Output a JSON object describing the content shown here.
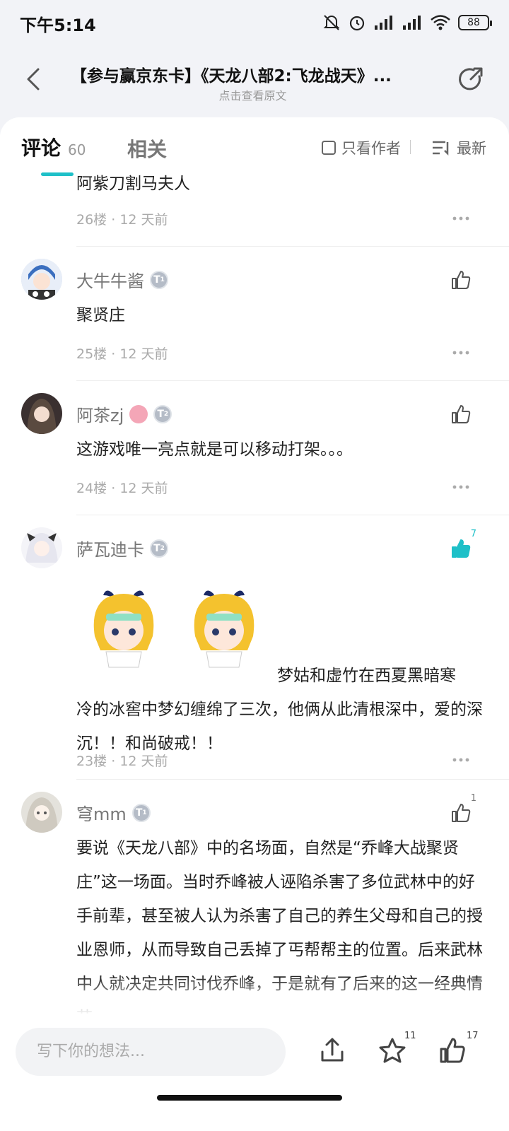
{
  "status_bar": {
    "time": "下午5:14",
    "battery": "88"
  },
  "header": {
    "title": "【参与赢京东卡】《天龙八部2:飞龙战天》...",
    "subtitle": "点击查看原文"
  },
  "tabs": {
    "comments_label": "评论",
    "comments_count": "60",
    "related_label": "相关",
    "only_author": "只看作者",
    "sort": "最新"
  },
  "comments": [
    {
      "text": "阿紫刀割马夫人",
      "floor": "26楼",
      "time": "12 天前"
    },
    {
      "user": "大牛牛酱",
      "level": "1",
      "text": "聚贤庄",
      "floor": "25楼",
      "time": "12 天前"
    },
    {
      "user": "阿茶zj",
      "level": "2",
      "text": "这游戏唯一亮点就是可以移动打架。。。",
      "floor": "24楼",
      "time": "12 天前"
    },
    {
      "user": "萨瓦迪卡",
      "level": "2",
      "likes": "7",
      "text_line1": "梦姑和虚竹在西夏黑暗寒",
      "text_rest": "冷的冰窖中梦幻缠绵了三次，他俩从此清根深中，爱的深沉！！和尚破戒！！",
      "floor": "23楼",
      "time": "12 天前"
    },
    {
      "user": "穹mm",
      "level": "1",
      "likes": "1",
      "text": "要说《天龙八部》中的名场面，自然是“乔峰大战聚贤庄”这一场面。当时乔峰被人诬陷杀害了多位武林中的好手前辈，甚至被人认为杀害了自己的养生父母和自己的授业恩师，从而导致自己丢掉了丐帮帮主的位置。后来武林中人就决定共同讨伐乔峰，于是就有了后来的这一经典情节。"
    }
  ],
  "bottom_bar": {
    "input_placeholder": "写下你的想法...",
    "star_count": "11",
    "like_count": "17"
  },
  "colors": {
    "accent": "#1ec0c8",
    "background": "#f2f3f7"
  }
}
